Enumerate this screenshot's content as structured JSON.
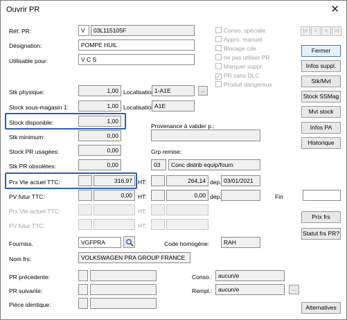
{
  "window": {
    "title": "Ouvrir PR",
    "close_glyph": "✕"
  },
  "ref": {
    "label": "Réf. PR:",
    "prefix": "V",
    "value": "03L115105F",
    "designation_label": "Désignation:",
    "designation": "POMPE HUIL",
    "utilisable_label": "Utilisable pour:",
    "utilisable": "V C S"
  },
  "flags": [
    {
      "label": "Conso. spéciale",
      "checked": false
    },
    {
      "label": "Appro. manuel",
      "checked": false
    },
    {
      "label": "Blocage cde",
      "checked": false
    },
    {
      "label": "ne pas utiliser PR",
      "checked": false
    },
    {
      "label": "Marquer suppr.",
      "checked": false
    },
    {
      "label": "PR sans DLC",
      "checked": true,
      "mark": "✓"
    },
    {
      "label": "Produit dangereux",
      "checked": false
    }
  ],
  "nav": {
    "first": "|<",
    "prev": "<",
    "next": ">",
    "last": ">|"
  },
  "buttons": {
    "fermer": "Fermer",
    "infos_suppl": "Infos suppl.",
    "stk_mvt": "Stk/Mvt",
    "stock_ssmag": "Stock SSMag",
    "mvt_stock": "Mvt stock",
    "infos_pa": "Infos PA",
    "historique": "Historique",
    "prix_frs": "Prix frs",
    "statut_frs": "Statut frs PR?",
    "alternatives": "Alternatives",
    "loc_button": "..",
    "rempl_button": "..."
  },
  "stock": {
    "physique_label": "Stk physique:",
    "physique": "1,00",
    "localisation_label": "Localisation",
    "localisation1": "1-A1E",
    "localisation2": "A1E",
    "sous_magasin_label": "Stock sous-magasin 1:",
    "sous_magasin": "1,00",
    "disponible_label": "Stock disponible:",
    "disponible": "1,00",
    "minimum_label": "Stk minimum:",
    "minimum": "0,00",
    "usagees_label": "Stock PR usagées:",
    "usagees": "0,00",
    "obsoletes_label": "Stk PR obsolètes:",
    "obsoletes": "0,00",
    "provenance_label": "Provenance à valider p.:",
    "grp_remise_label": "Grp remise:",
    "grp_remise_code": "03",
    "grp_remise_desc": "Conc distrib equip/fourn"
  },
  "prices": {
    "vte_ttc_label": "Prx Vte actuel TTC:",
    "vte_ttc": "316,97",
    "ht_label": "HT:",
    "ht": "264,14",
    "dep_label": "dep.",
    "dep_date": "03/01/2021",
    "futur_ttc_label": "PV futur TTC:",
    "futur_ttc": "0,00",
    "futur_ht": "0,00",
    "fin_label": "Fin",
    "vte_actuel_dis_label": "Prx Vte actuel TTC:",
    "futur_dis_label": "PV futur TTC:"
  },
  "supplier": {
    "fourniss_label": "Fourniss.",
    "fourniss": "VGFPRA",
    "search_icon": "magnifier",
    "code_homogene_label": "Code homogène:",
    "code_homogene": "RAH",
    "nom_label": "Nom frs:",
    "nom": "VOLKSWAGEN PRA GROUP FRANCE"
  },
  "replacement": {
    "precedente_label": "PR précedente:",
    "suivante_label": "PR suivante:",
    "identique_label": "Pièce identique:",
    "conso_label": "Conso.:",
    "conso": "aucun/e",
    "rempl_label": "Rempl.:",
    "rempl": "aucun/e"
  },
  "colors": {
    "highlight": "#2a5db0",
    "field_bg": "#f0f0f0",
    "default_button_border": "#3c7fb1"
  }
}
